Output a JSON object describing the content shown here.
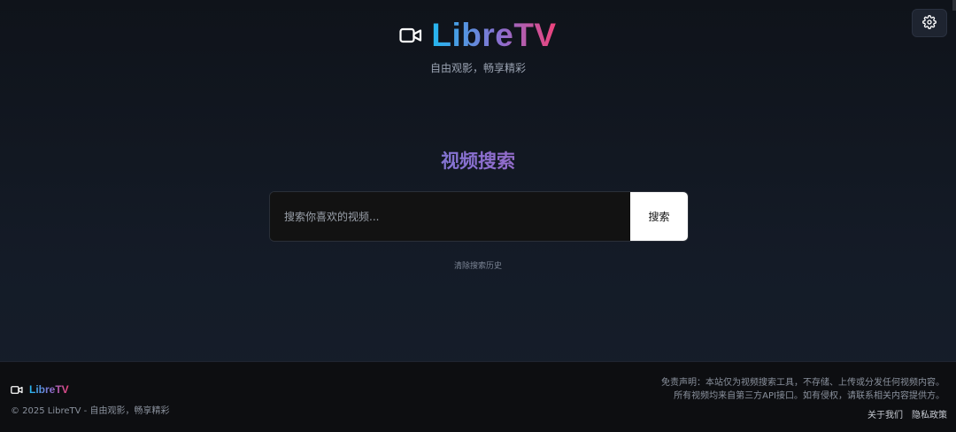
{
  "header": {
    "logo_text": "LibreTV",
    "tagline": "自由观影，畅享精彩",
    "settings_icon": "gear-icon"
  },
  "search": {
    "title": "视频搜索",
    "placeholder": "搜索你喜欢的视频...",
    "button_label": "搜索",
    "clear_history": "清除搜索历史"
  },
  "footer": {
    "logo_text": "LibreTV",
    "copyright": "© 2025 LibreTV - 自由观影，畅享精彩",
    "disclaimer_line1": "免责声明：本站仅为视频搜索工具，不存储、上传或分发任何视频内容。",
    "disclaimer_line2": "所有视频均来自第三方API接口。如有侵权，请联系相关内容提供方。",
    "links": [
      "关于我们",
      "隐私政策"
    ]
  },
  "colors": {
    "gradient_start": "#22b8f0",
    "gradient_mid": "#8b6fd0",
    "gradient_end": "#f0427a",
    "background": "#141b27"
  }
}
